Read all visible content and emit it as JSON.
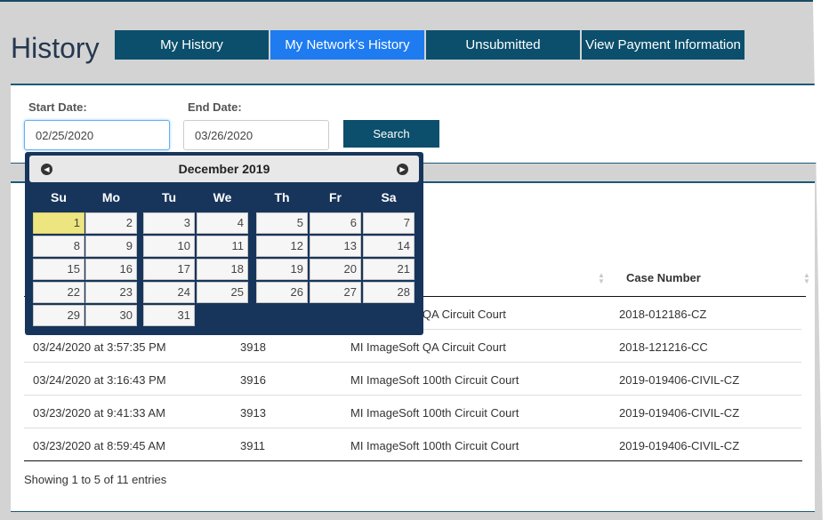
{
  "page": {
    "title": "History"
  },
  "tabs": [
    {
      "label": "My History"
    },
    {
      "label": "My Network's History",
      "active": true
    },
    {
      "label": "Unsubmitted"
    },
    {
      "label": "View Payment Information"
    }
  ],
  "filters": {
    "start_label": "Start Date:",
    "start_value": "02/25/2020",
    "end_label": "End Date:",
    "end_value": "03/26/2020",
    "search_label": "Search"
  },
  "calendar": {
    "month": "December 2019",
    "day_names": [
      "Su",
      "Mo",
      "Tu",
      "We",
      "Th",
      "Fr",
      "Sa"
    ],
    "highlighted_day": 1,
    "days": 31,
    "first_weekday": 0
  },
  "table": {
    "headers": {
      "case_number": "Case Number"
    },
    "rows": [
      {
        "date": "",
        "id": "",
        "court": "MI ImageSoft QA Circuit Court",
        "case": "2018-012186-CZ"
      },
      {
        "date": "03/24/2020 at 3:57:35 PM",
        "id": "3918",
        "court": "MI ImageSoft QA Circuit Court",
        "case": "2018-121216-CC"
      },
      {
        "date": "03/24/2020 at 3:16:43 PM",
        "id": "3916",
        "court": "MI ImageSoft 100th Circuit Court",
        "case": "2019-019406-CIVIL-CZ"
      },
      {
        "date": "03/23/2020 at 9:41:33 AM",
        "id": "3913",
        "court": "MI ImageSoft 100th Circuit Court",
        "case": "2019-019406-CIVIL-CZ"
      },
      {
        "date": "03/23/2020 at 8:59:45 AM",
        "id": "3911",
        "court": "MI ImageSoft 100th Circuit Court",
        "case": "2019-019406-CIVIL-CZ"
      }
    ],
    "info": "Showing 1 to 5 of 11 entries"
  },
  "colors": {
    "tab": "#0b4f6c",
    "tab_active": "#1e7bf0",
    "calendar_bg": "#17355b",
    "highlight": "#ede57f"
  }
}
